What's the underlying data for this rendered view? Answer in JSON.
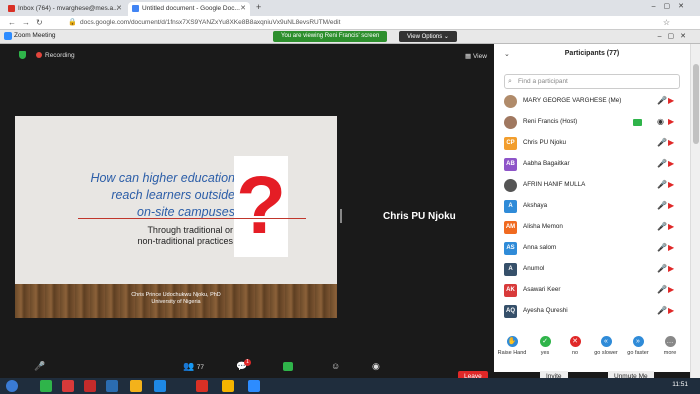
{
  "browser": {
    "tabs": [
      {
        "label": "Inbox (764) - mvarghese@mes.a...",
        "color": "#d93025"
      },
      {
        "label": "Untitled document - Google Doc...",
        "color": "#4285f4"
      }
    ],
    "url": "docs.google.com/document/d/1fnsx7XS9YANZxYu8XKe8B8axqniuVx9uNL8evsRUTM/edit"
  },
  "zoom": {
    "title": "Zoom Meeting",
    "viewing_banner": "You are viewing Reni Francis' screen",
    "view_options": "View Options ⌄",
    "recording": "Recording",
    "view": "View"
  },
  "slide": {
    "heading": "How can higher education reach learners outside on-site campuses",
    "heading_lines": [
      "How can higher education",
      "reach learners outside",
      "on-site campuses"
    ],
    "question": "?",
    "sub_lines": [
      "Through traditional or",
      "non-traditional practices"
    ],
    "author_lines": [
      "Chris Prince Udochukwu Njoku, PhD",
      "University of Nigeria"
    ]
  },
  "speaker": "Chris PU Njoku",
  "participants": {
    "title": "Participants (77)",
    "search_placeholder": "Find a participant",
    "list": [
      {
        "initials": "",
        "name": "MARY GEORGE VARGHESE (Me)",
        "color": "#b08b6a",
        "photo": true
      },
      {
        "initials": "",
        "name": "Reni Francis (Host)",
        "color": "#a07860",
        "photo": true
      },
      {
        "initials": "CP",
        "name": "Chris PU Njoku",
        "color": "#f29e2e"
      },
      {
        "initials": "AB",
        "name": "Aabha Bagaitkar",
        "color": "#8e55c8"
      },
      {
        "initials": "",
        "name": "AFRIN HANIF MULLA",
        "color": "#555555",
        "photo": true
      },
      {
        "initials": "A",
        "name": "Akshaya",
        "color": "#2f8bd8"
      },
      {
        "initials": "AM",
        "name": "Alisha Memon",
        "color": "#f06a20"
      },
      {
        "initials": "AS",
        "name": "Anna salom",
        "color": "#2f8bd8"
      },
      {
        "initials": "A",
        "name": "Anumol",
        "color": "#36506a"
      },
      {
        "initials": "AK",
        "name": "Asawari Keer",
        "color": "#d83a3a"
      },
      {
        "initials": "AQ",
        "name": "Ayesha Qureshi",
        "color": "#36506a"
      }
    ],
    "feedback": [
      {
        "label": "Raise Hand",
        "icon": "✋",
        "color": "#2f8bd8"
      },
      {
        "label": "yes",
        "icon": "✓",
        "color": "#2fb44a"
      },
      {
        "label": "no",
        "icon": "✕",
        "color": "#e02828"
      },
      {
        "label": "go slower",
        "icon": "«",
        "color": "#2f8bd8"
      },
      {
        "label": "go faster",
        "icon": "»",
        "color": "#2f8bd8"
      },
      {
        "label": "more",
        "icon": "…",
        "color": "#888888"
      }
    ],
    "invite": "Invite",
    "unmute_me": "Unmute Me"
  },
  "controls": {
    "participants_count": "77",
    "leave": "Leave",
    "chat_badge": "1"
  },
  "taskbar": {
    "time": "11:51"
  }
}
